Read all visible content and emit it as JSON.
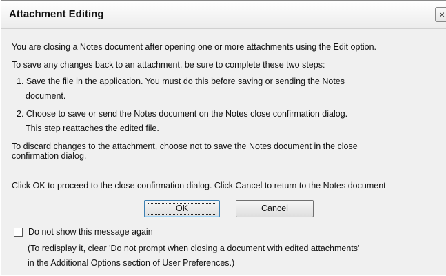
{
  "window": {
    "title": "Attachment Editing",
    "close_glyph": "×"
  },
  "message": {
    "intro": "You are closing a Notes document after opening one or more attachments using the Edit option.",
    "steps_intro": "To save any changes back to an attachment, be sure to complete these two steps:",
    "step1_line1": "1. Save the file in the application. You must do this before saving or sending the Notes",
    "step1_line2": "document.",
    "step2_line1": "2. Choose to save or send the Notes document on the Notes close confirmation dialog.",
    "step2_line2": "This step reattaches the edited file.",
    "discard_line1": "To discard changes to the attachment, choose not to save the Notes document in the close",
    "discard_line2": "confirmation dialog.",
    "proceed": "Click OK to proceed to the close confirmation dialog. Click Cancel to return to the Notes document"
  },
  "buttons": {
    "ok_label": "OK",
    "cancel_label": "Cancel"
  },
  "checkbox": {
    "label": "Do not show this message again",
    "checked": false,
    "note_line1": "(To redisplay it, clear 'Do not prompt when closing a document with edited attachments'",
    "note_line2": "in the Additional Options section of User Preferences.)"
  }
}
